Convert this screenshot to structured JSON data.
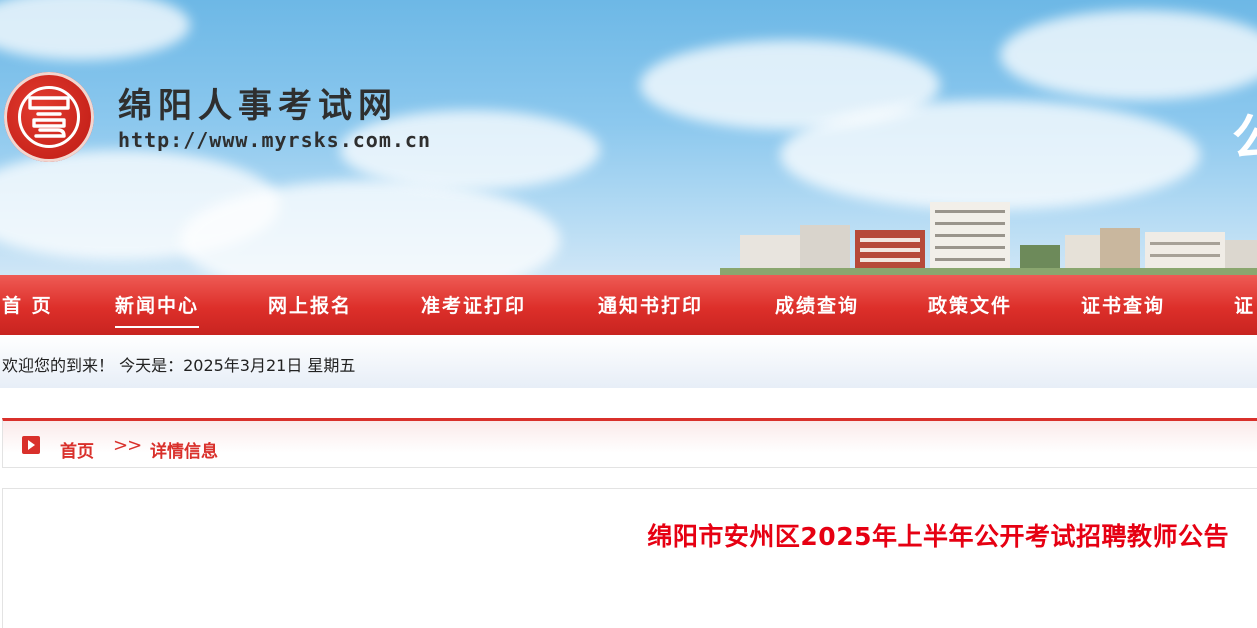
{
  "site": {
    "name": "绵阳人事考试网",
    "url": "http://www.myrsks.com.cn",
    "banner_edge_char": "公"
  },
  "nav": {
    "items": [
      {
        "label": "首 页"
      },
      {
        "label": "新闻中心",
        "active": true
      },
      {
        "label": "网上报名"
      },
      {
        "label": "准考证打印"
      },
      {
        "label": "通知书打印"
      },
      {
        "label": "成绩查询"
      },
      {
        "label": "政策文件"
      },
      {
        "label": "证书查询"
      },
      {
        "label": "证"
      }
    ]
  },
  "welcome": {
    "text": "欢迎您的到来！ 今天是：2025年3月21日 星期五"
  },
  "breadcrumb": {
    "home": "首页",
    "separator": ">>",
    "current": "详情信息"
  },
  "article": {
    "title": "绵阳市安州区2025年上半年公开考试招聘教师公告"
  },
  "colors": {
    "accent": "#d9302b",
    "title_red": "#e60012",
    "nav_red": "#dd2f2a"
  }
}
